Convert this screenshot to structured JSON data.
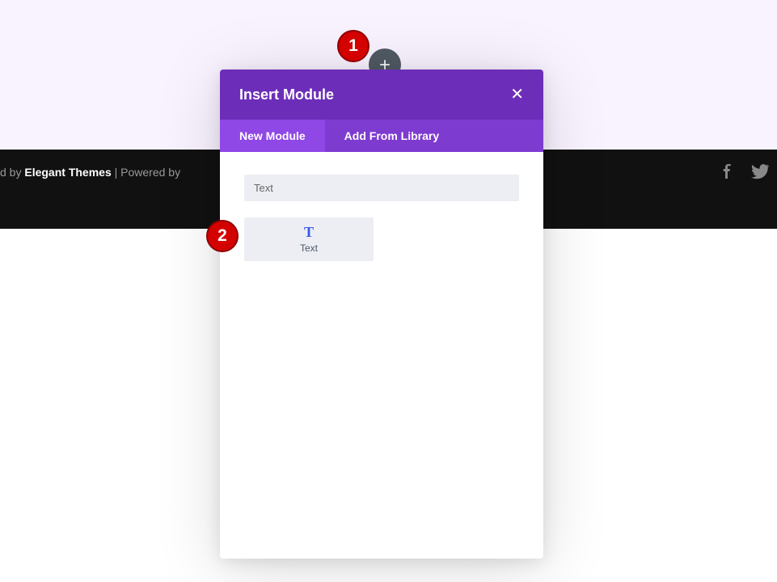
{
  "footer": {
    "prefix": "d by ",
    "brand": "Elegant Themes",
    "mid": " | Powered by ",
    "suffix": ""
  },
  "callouts": {
    "one": "1",
    "two": "2"
  },
  "modal": {
    "title": "Insert Module",
    "close": "✕",
    "tabs": {
      "new": "New Module",
      "library": "Add From Library"
    },
    "search": {
      "value": "Text"
    },
    "module": {
      "iconGlyph": "T",
      "label": "Text"
    }
  }
}
